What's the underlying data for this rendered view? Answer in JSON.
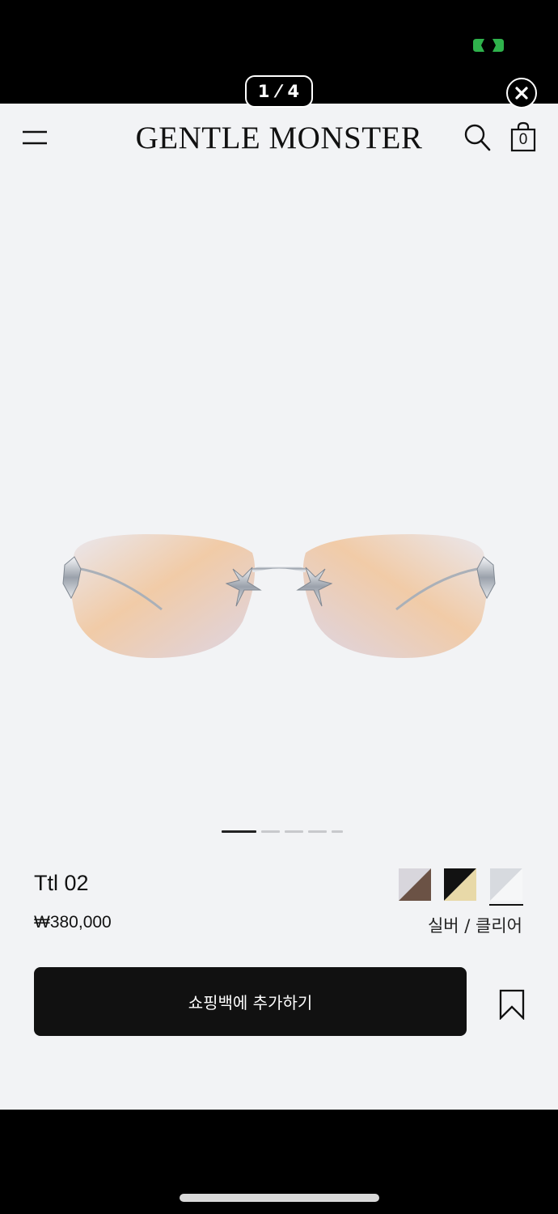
{
  "viewer": {
    "counter": "1 ⁄ 4",
    "close_icon": "close-icon"
  },
  "header": {
    "brand": "GENTLE MONSTER",
    "bag_count": "0",
    "menu_icon": "hamburger-menu-icon",
    "search_icon": "search-icon",
    "bag_icon": "shopping-bag-icon"
  },
  "product": {
    "name": "Ttl 02",
    "price": "₩380,000",
    "selected_color": "실버 / 클리어",
    "image_count": 5,
    "active_image": 1,
    "swatches": [
      {
        "name": "brown-gradient",
        "colors": [
          "#d8d6dc",
          "#6b5245"
        ]
      },
      {
        "name": "black-gold",
        "colors": [
          "#121212",
          "#e8d9a8"
        ]
      },
      {
        "name": "silver-clear",
        "colors": [
          "#d7dadf",
          "#f6f7f8"
        ]
      }
    ]
  },
  "actions": {
    "add_to_bag": "쇼핑백에 추가하기",
    "wishlist_icon": "bookmark-icon"
  },
  "colors": {
    "background": "#f2f3f5",
    "button": "#111111",
    "status_green": "#2fb24c"
  }
}
